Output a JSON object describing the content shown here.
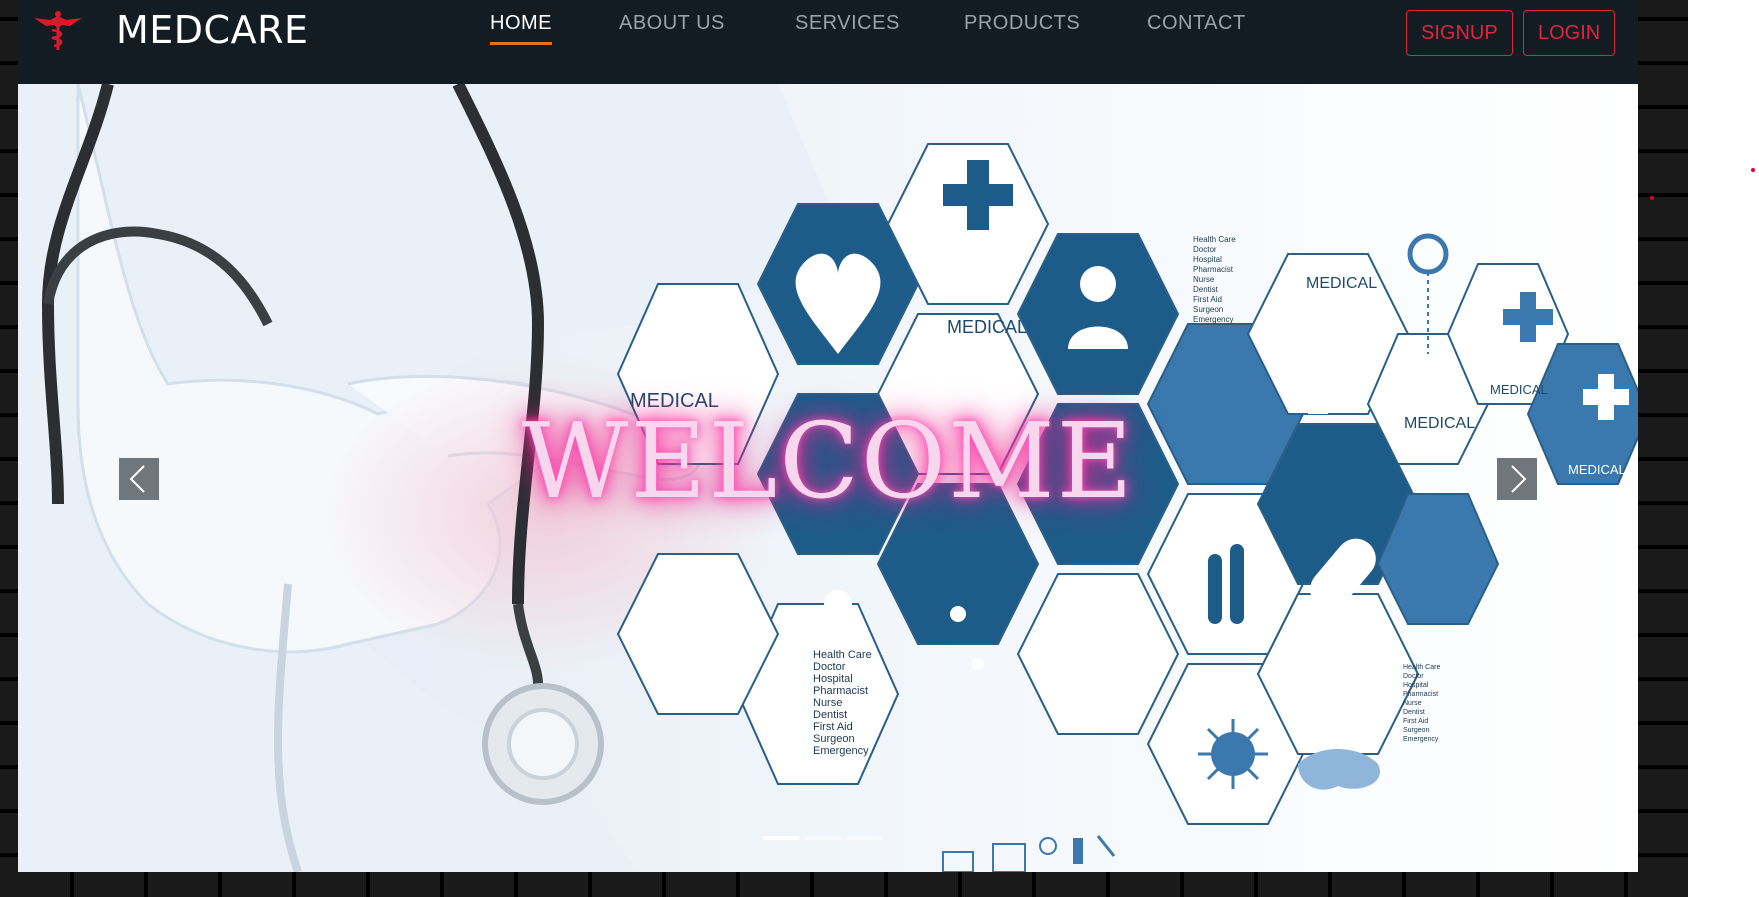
{
  "brand": {
    "name": "MEDCARE",
    "logo_icon": "caduceus-icon"
  },
  "nav": {
    "items": [
      {
        "label": "HOME",
        "active": true
      },
      {
        "label": "ABOUT US",
        "active": false
      },
      {
        "label": "SERVICES",
        "active": false
      },
      {
        "label": "PRODUCTS",
        "active": false
      },
      {
        "label": "CONTACT",
        "active": false
      }
    ]
  },
  "auth": {
    "signup": "SIGNUP",
    "login": "LOGIN"
  },
  "hero": {
    "headline": "WELCOME",
    "tile_labels": {
      "medical": "MEDICAL",
      "list": [
        "Health Care",
        "Doctor",
        "Hospital",
        "Pharmacist",
        "Nurse",
        "Dentist",
        "First Aid",
        "Surgeon",
        "Emergency"
      ]
    },
    "prev_icon": "chevron-left-icon",
    "next_icon": "chevron-right-icon",
    "slide_count": 3,
    "active_slide": 1
  },
  "colors": {
    "navbar": "#131c23",
    "accent_underline": "#e3731c",
    "auth": "#e0243d",
    "tile_blue": "#1f5f8b",
    "tile_light": "#3a78ad",
    "welcome_glow": "#ff2aa1"
  }
}
